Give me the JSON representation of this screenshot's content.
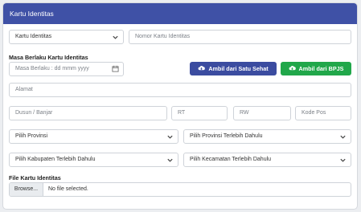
{
  "card": {
    "title": "Kartu Identitas"
  },
  "colors": {
    "header": "#3f51a6",
    "btn_satusehat": "#3b4ca0",
    "btn_bpjs": "#21a74a"
  },
  "identity": {
    "type_selected": "Kartu Identitas",
    "number_placeholder": "Nomor Kartu Identitas"
  },
  "expiry": {
    "label": "Masa Berlaku Kartu Identitas",
    "placeholder": "Masa Berlaku : dd mmm yyyy"
  },
  "buttons": {
    "satusehat": "Ambil dari Satu Sehat",
    "bpjs": "Ambil dari BPJS"
  },
  "address": {
    "alamat_placeholder": "Alamat",
    "dusun_placeholder": "Dusun / Banjar",
    "rt_placeholder": "RT",
    "rw_placeholder": "RW",
    "kodepos_placeholder": "Kode Pos"
  },
  "region": {
    "provinsi": "Pilih Provinsi",
    "kabupaten": "Pilih Provinsi Terlebih Dahulu",
    "kecamatan": "Pilih Kabupaten Terlebih Dahulu",
    "desa": "Pilih Kecamatan Terlebih Dahulu"
  },
  "file": {
    "label": "File Kartu Identitas",
    "browse": "Browse...",
    "status": "No file selected."
  }
}
